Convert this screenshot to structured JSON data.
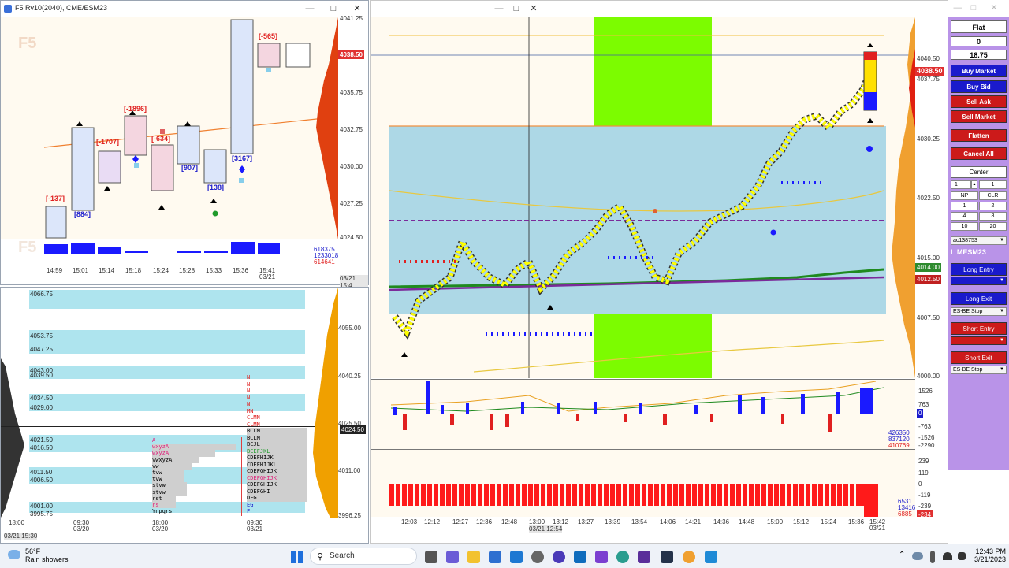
{
  "left_window": {
    "title": "F5 Rv10(2040), CME/ESM23",
    "watermark": "F5",
    "price_axis": [
      "4041.25",
      "4035.75",
      "4032.75",
      "4030.00",
      "4027.25",
      "4024.50"
    ],
    "current_price": "4038.50",
    "delta_labels": [
      "[-565]",
      "[-1896]",
      "[-1707]",
      "[-634]",
      "[-137]",
      "[884]",
      "[907]",
      "[138]",
      "[3167]"
    ],
    "volume_values": [
      "618375",
      "1233018",
      "614641"
    ],
    "time_axis": [
      "14:59",
      "15:01",
      "15:14",
      "15:18",
      "15:24",
      "15:28",
      "15:33",
      "15:36",
      "15:41"
    ],
    "date_label": "03/21",
    "corner_time": "03/21 15:4"
  },
  "tpo_window": {
    "levels": [
      "4066.75",
      "4053.75",
      "4047.25",
      "4043.00",
      "4039.50",
      "4034.50",
      "4029.00",
      "4021.50",
      "4016.50",
      "4011.50",
      "4006.50",
      "4001.00",
      "3995.75"
    ],
    "price_axis": [
      "4055.00",
      "4040.25",
      "4025.50",
      "4011.00",
      "3996.25"
    ],
    "price_tag": "4024.50",
    "letters_left": [
      "A",
      "wxyzA",
      "wxyzA",
      "vwxyzA",
      "vw",
      "tvw",
      "tvw",
      "stvw",
      "stvw",
      "rst",
      "rs",
      "Ynpqrs"
    ],
    "letters_right": [
      "N",
      "N",
      "N",
      "N",
      "N",
      "MN",
      "CLMN",
      "CLMN",
      "BCLM",
      "BCLM",
      "BCJL",
      "BCEFJKL",
      "CDEFHIJK",
      "CDEFHIJKL",
      "CDEFGHIJK",
      "CDEFGHIJK",
      "CDEFGHIJK",
      "CDEFGHI",
      "DFG",
      "EG",
      "F"
    ],
    "time_axis": [
      "18:00",
      "09:30",
      "18:00",
      "09:30"
    ],
    "date_axis": [
      "03/20",
      "03/21"
    ],
    "corner_time": "03/21 15:30"
  },
  "main_chart": {
    "price_axis": [
      "4040.50",
      "4037.75",
      "4030.25",
      "4022.50",
      "4015.00",
      "4007.50",
      "4000.00"
    ],
    "price_tags": [
      {
        "text": "4038.50",
        "color": "#e03030"
      },
      {
        "text": "4014.00",
        "color": "#2e8b2e"
      },
      {
        "text": "4012.50",
        "color": "#c02020"
      }
    ],
    "delta_axis": [
      "1526",
      "763",
      "0",
      "-763",
      "-1526",
      "-2290"
    ],
    "delta_tag": "0",
    "delta_values": [
      "426350",
      "837120",
      "410769"
    ],
    "cum_axis": [
      "239",
      "119",
      "0",
      "-119",
      "-239"
    ],
    "cum_values": [
      "6531",
      "13416",
      "6885"
    ],
    "cum_tag": "-234",
    "time_axis": [
      "12:03",
      "12:12",
      "12:27",
      "12:36",
      "12:48",
      "13:00",
      "13:12",
      "13:27",
      "13:39",
      "13:54",
      "14:06",
      "14:21",
      "14:36",
      "14:48",
      "15:00",
      "15:12",
      "15:24",
      "15:36",
      "15:42"
    ],
    "date_label": "03/21",
    "cursor_time": "03/21 12:54"
  },
  "order_panel": {
    "status": "Flat",
    "position": "0",
    "pnl": "18.75",
    "buy_market": "Buy Market",
    "buy_bid": "Buy Bid",
    "sell_ask": "Sell Ask",
    "sell_market": "Sell Market",
    "flatten": "Flatten",
    "cancel_all": "Cancel All",
    "center": "Center",
    "qty1": "1",
    "qty2": "1",
    "np": "NP",
    "clr": "CLR",
    "q_1": "1",
    "q_2": "2",
    "q_4": "4",
    "q_8": "8",
    "q_10": "10",
    "q_20": "20",
    "account": "ac138753",
    "instrument": "L MESM23",
    "long_entry": "Long Entry",
    "long_exit": "Long Exit",
    "long_exit_strategy": "ES-BE Stop",
    "short_entry": "Short Entry",
    "short_exit": "Short Exit",
    "short_exit_strategy": "ES-BE Stop"
  },
  "taskbar": {
    "weather_temp": "56°F",
    "weather_desc": "Rain showers",
    "search": "Search",
    "time": "12:43 PM",
    "date": "3/21/2023"
  },
  "colors": {
    "value_area": "#add8e6",
    "session_band": "#7cfc00",
    "candle": "#ffff00",
    "buy_blue": "#1a1aff",
    "sell_red": "#ff1a1a",
    "panel": "#b993e8",
    "button_blue": "#1a1acc",
    "button_red": "#cc1a1a"
  }
}
